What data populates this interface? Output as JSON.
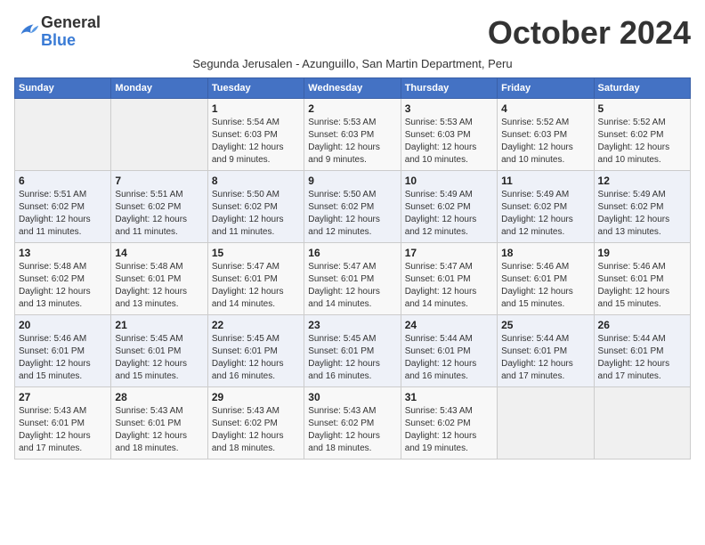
{
  "header": {
    "logo_general": "General",
    "logo_blue": "Blue",
    "month_title": "October 2024",
    "subtitle": "Segunda Jerusalen - Azunguillo, San Martin Department, Peru"
  },
  "weekdays": [
    "Sunday",
    "Monday",
    "Tuesday",
    "Wednesday",
    "Thursday",
    "Friday",
    "Saturday"
  ],
  "weeks": [
    [
      {
        "day": "",
        "info": ""
      },
      {
        "day": "",
        "info": ""
      },
      {
        "day": "1",
        "info": "Sunrise: 5:54 AM\nSunset: 6:03 PM\nDaylight: 12 hours\nand 9 minutes."
      },
      {
        "day": "2",
        "info": "Sunrise: 5:53 AM\nSunset: 6:03 PM\nDaylight: 12 hours\nand 9 minutes."
      },
      {
        "day": "3",
        "info": "Sunrise: 5:53 AM\nSunset: 6:03 PM\nDaylight: 12 hours\nand 10 minutes."
      },
      {
        "day": "4",
        "info": "Sunrise: 5:52 AM\nSunset: 6:03 PM\nDaylight: 12 hours\nand 10 minutes."
      },
      {
        "day": "5",
        "info": "Sunrise: 5:52 AM\nSunset: 6:02 PM\nDaylight: 12 hours\nand 10 minutes."
      }
    ],
    [
      {
        "day": "6",
        "info": "Sunrise: 5:51 AM\nSunset: 6:02 PM\nDaylight: 12 hours\nand 11 minutes."
      },
      {
        "day": "7",
        "info": "Sunrise: 5:51 AM\nSunset: 6:02 PM\nDaylight: 12 hours\nand 11 minutes."
      },
      {
        "day": "8",
        "info": "Sunrise: 5:50 AM\nSunset: 6:02 PM\nDaylight: 12 hours\nand 11 minutes."
      },
      {
        "day": "9",
        "info": "Sunrise: 5:50 AM\nSunset: 6:02 PM\nDaylight: 12 hours\nand 12 minutes."
      },
      {
        "day": "10",
        "info": "Sunrise: 5:49 AM\nSunset: 6:02 PM\nDaylight: 12 hours\nand 12 minutes."
      },
      {
        "day": "11",
        "info": "Sunrise: 5:49 AM\nSunset: 6:02 PM\nDaylight: 12 hours\nand 12 minutes."
      },
      {
        "day": "12",
        "info": "Sunrise: 5:49 AM\nSunset: 6:02 PM\nDaylight: 12 hours\nand 13 minutes."
      }
    ],
    [
      {
        "day": "13",
        "info": "Sunrise: 5:48 AM\nSunset: 6:02 PM\nDaylight: 12 hours\nand 13 minutes."
      },
      {
        "day": "14",
        "info": "Sunrise: 5:48 AM\nSunset: 6:01 PM\nDaylight: 12 hours\nand 13 minutes."
      },
      {
        "day": "15",
        "info": "Sunrise: 5:47 AM\nSunset: 6:01 PM\nDaylight: 12 hours\nand 14 minutes."
      },
      {
        "day": "16",
        "info": "Sunrise: 5:47 AM\nSunset: 6:01 PM\nDaylight: 12 hours\nand 14 minutes."
      },
      {
        "day": "17",
        "info": "Sunrise: 5:47 AM\nSunset: 6:01 PM\nDaylight: 12 hours\nand 14 minutes."
      },
      {
        "day": "18",
        "info": "Sunrise: 5:46 AM\nSunset: 6:01 PM\nDaylight: 12 hours\nand 15 minutes."
      },
      {
        "day": "19",
        "info": "Sunrise: 5:46 AM\nSunset: 6:01 PM\nDaylight: 12 hours\nand 15 minutes."
      }
    ],
    [
      {
        "day": "20",
        "info": "Sunrise: 5:46 AM\nSunset: 6:01 PM\nDaylight: 12 hours\nand 15 minutes."
      },
      {
        "day": "21",
        "info": "Sunrise: 5:45 AM\nSunset: 6:01 PM\nDaylight: 12 hours\nand 15 minutes."
      },
      {
        "day": "22",
        "info": "Sunrise: 5:45 AM\nSunset: 6:01 PM\nDaylight: 12 hours\nand 16 minutes."
      },
      {
        "day": "23",
        "info": "Sunrise: 5:45 AM\nSunset: 6:01 PM\nDaylight: 12 hours\nand 16 minutes."
      },
      {
        "day": "24",
        "info": "Sunrise: 5:44 AM\nSunset: 6:01 PM\nDaylight: 12 hours\nand 16 minutes."
      },
      {
        "day": "25",
        "info": "Sunrise: 5:44 AM\nSunset: 6:01 PM\nDaylight: 12 hours\nand 17 minutes."
      },
      {
        "day": "26",
        "info": "Sunrise: 5:44 AM\nSunset: 6:01 PM\nDaylight: 12 hours\nand 17 minutes."
      }
    ],
    [
      {
        "day": "27",
        "info": "Sunrise: 5:43 AM\nSunset: 6:01 PM\nDaylight: 12 hours\nand 17 minutes."
      },
      {
        "day": "28",
        "info": "Sunrise: 5:43 AM\nSunset: 6:01 PM\nDaylight: 12 hours\nand 18 minutes."
      },
      {
        "day": "29",
        "info": "Sunrise: 5:43 AM\nSunset: 6:02 PM\nDaylight: 12 hours\nand 18 minutes."
      },
      {
        "day": "30",
        "info": "Sunrise: 5:43 AM\nSunset: 6:02 PM\nDaylight: 12 hours\nand 18 minutes."
      },
      {
        "day": "31",
        "info": "Sunrise: 5:43 AM\nSunset: 6:02 PM\nDaylight: 12 hours\nand 19 minutes."
      },
      {
        "day": "",
        "info": ""
      },
      {
        "day": "",
        "info": ""
      }
    ]
  ]
}
